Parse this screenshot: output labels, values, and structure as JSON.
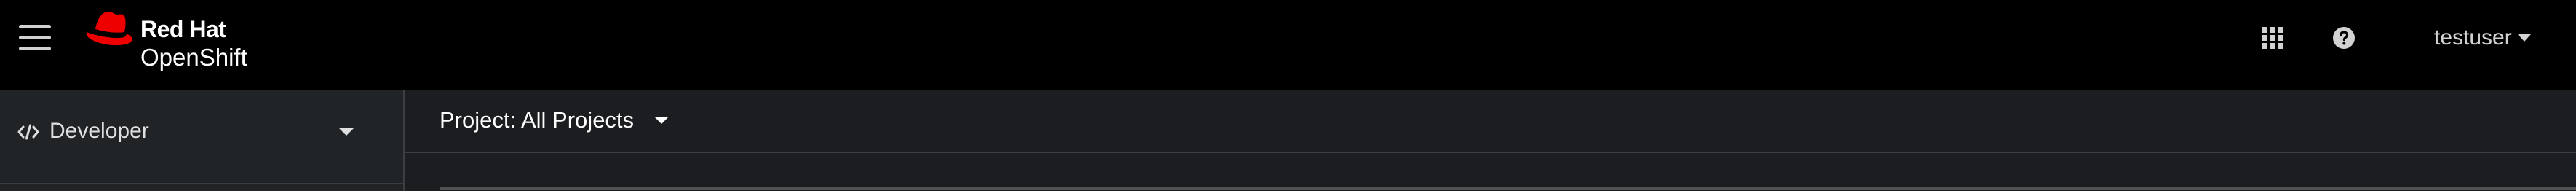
{
  "masthead": {
    "brand_line1": "Red Hat",
    "brand_line2": "OpenShift",
    "user_name": "testuser",
    "icons": [
      "hamburger-icon",
      "redhat-logo-icon",
      "apps-grid-icon",
      "help-icon",
      "caret-down-icon"
    ]
  },
  "sidebar": {
    "perspective_label": "Developer",
    "perspective_icon": "code-icon"
  },
  "content": {
    "project_selector_label": "Project: All Projects"
  },
  "colors": {
    "masthead_bg": "#000000",
    "sidebar_bg": "#212427",
    "content_bg": "#1b1d21",
    "redhat_red": "#ee0000",
    "text": "#e0e0e0"
  }
}
